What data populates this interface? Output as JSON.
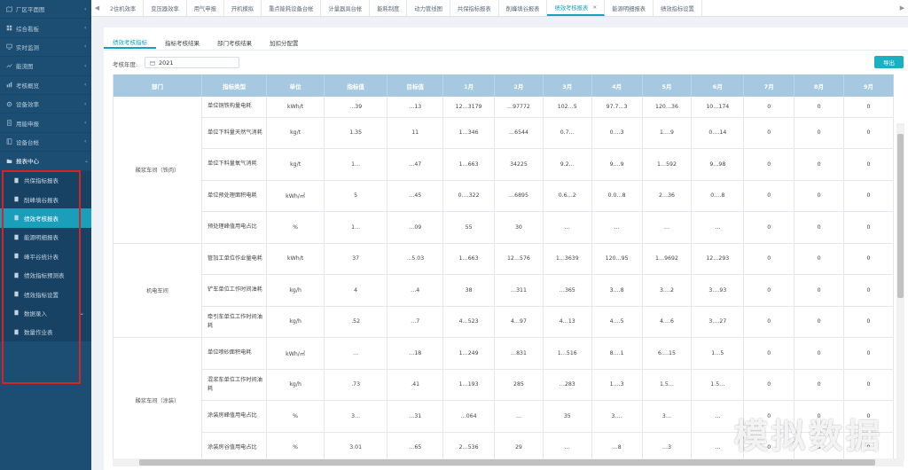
{
  "sidebar": {
    "items": [
      {
        "label": "厂区平面图",
        "icon": "map-icon"
      },
      {
        "label": "综合看板",
        "icon": "dashboard-icon"
      },
      {
        "label": "实时监测",
        "icon": "monitor-icon"
      },
      {
        "label": "能流图",
        "icon": "flow-icon"
      },
      {
        "label": "考核概览",
        "icon": "chart-icon"
      },
      {
        "label": "设备效率",
        "icon": "gear-icon"
      },
      {
        "label": "用能申报",
        "icon": "report-icon"
      },
      {
        "label": "设备台帐",
        "icon": "ledger-icon"
      },
      {
        "label": "报表中心",
        "icon": "folder-icon"
      }
    ],
    "sub_items": [
      {
        "label": "共保指标报表"
      },
      {
        "label": "削峰填谷报表"
      },
      {
        "label": "绩效考核报表"
      },
      {
        "label": "能源明细报表"
      },
      {
        "label": "峰平谷统计表"
      },
      {
        "label": "绩效指标预测表"
      },
      {
        "label": "绩效指标设置"
      },
      {
        "label": "数据录入"
      },
      {
        "label": "数量作业表"
      }
    ]
  },
  "tabs": [
    "2住机效率",
    "变压器效率",
    "用气申报",
    "开机模拟",
    "重点能耗设备台帐",
    "计量器具台帐",
    "能耗制度",
    "动力管线图",
    "共保指标报表",
    "削峰填谷报表",
    "绩效考核报表",
    "能源明细报表",
    "绩效指标设置"
  ],
  "active_tab": "绩效考核报表",
  "subtabs": [
    "绩效考核指标",
    "指标考核结果",
    "部门考核结果",
    "加扣分配置"
  ],
  "filter": {
    "year_label": "考核年度:",
    "year_value": "2021"
  },
  "export_label": "导出",
  "table": {
    "headers": [
      "部门",
      "指标类型",
      "单位",
      "指标值",
      "目标值",
      "1月",
      "2月",
      "3月",
      "4月",
      "5月",
      "6月",
      "7月",
      "8月",
      "9月"
    ],
    "groups": [
      {
        "dept": "酸浆车间（铁肉）",
        "rows": [
          [
            "单位铜铁构量电耗",
            "kWh/t",
            "…39",
            "…13",
            "12…3179",
            "…97772",
            "102…5",
            "97.7…3",
            "120…36",
            "10…174",
            "0",
            "0",
            "0"
          ],
          [
            "单位下料量天然气消耗",
            "kg/t",
            "1.35",
            "11",
            "1…346",
            "…6544",
            "0.7…",
            "0.…3",
            "1.…9",
            "0.…14",
            "0",
            "0",
            "0"
          ],
          [
            "单位下料量氧气消耗",
            "kg/t",
            "1…",
            "…47",
            "1…663",
            "34225",
            "9.2…",
            "9.…9",
            "1…592",
            "9…98",
            "0",
            "0",
            "0"
          ],
          [
            "单位预处理面积电耗",
            "kWh/㎡",
            "5",
            "…45",
            "0.…322",
            "…6895",
            "0.6…2",
            "0.0…8",
            "2…36",
            "0.…8",
            "0",
            "0",
            "0"
          ],
          [
            "预处理峰值用电占比",
            "%",
            "1…",
            "…09",
            "55",
            "30",
            "…",
            "…",
            "…",
            "…",
            "0",
            "0",
            "0"
          ]
        ]
      },
      {
        "dept": "机电车间",
        "rows": [
          [
            "管加工单位作业量电耗",
            "kWh/t",
            "37",
            "…5.03",
            "1…663",
            "12…576",
            "1…3639",
            "120…95",
            "1…9692",
            "12…293",
            "0",
            "0",
            "0"
          ],
          [
            "铲车单位工作时间油耗",
            "kg/h",
            "4",
            "…4",
            "38",
            "…311",
            "…365",
            "3.…8",
            "3.…2",
            "3.…93",
            "0",
            "0",
            "0"
          ],
          [
            "牵引车单位工作时间油耗",
            "kg/h",
            ".52",
            "…7",
            "4…523",
            "4…97",
            "4…13",
            "4.…5",
            "4.…6",
            "3.…27",
            "0",
            "0",
            "0"
          ]
        ]
      },
      {
        "dept": "酸浆车间（涂装）",
        "rows": [
          [
            "单位喷砂面积电耗",
            "kWh/㎡",
            "…",
            "…18",
            "1…249",
            "…831",
            "1…516",
            "8.…1",
            "6.…15",
            "1…5",
            "0",
            "0",
            "0"
          ],
          [
            "混浆车单位工作时间油耗",
            "kg/h",
            ".73",
            ".41",
            "1…193",
            "285",
            "…283",
            "1.…3",
            "1.5…",
            "1.5…",
            "0",
            "0",
            "0"
          ],
          [
            "涂装房峰值用电占比",
            "%",
            "3…",
            "…31",
            "…064",
            "…",
            "35",
            "3.…",
            "3…",
            "…",
            "0",
            "0",
            "0"
          ],
          [
            "涂装房谷值用电占比",
            "%",
            "3.01",
            "…65",
            "2…536",
            "29",
            "…",
            "…8",
            "…3",
            "…",
            "0",
            "0",
            "0"
          ]
        ]
      }
    ]
  },
  "watermark": "模拟数据",
  "colors": {
    "sidebar": "#1c4e74",
    "accent": "#1a9fbb",
    "header": "#a6c9e1",
    "highlight": "#d92323"
  }
}
